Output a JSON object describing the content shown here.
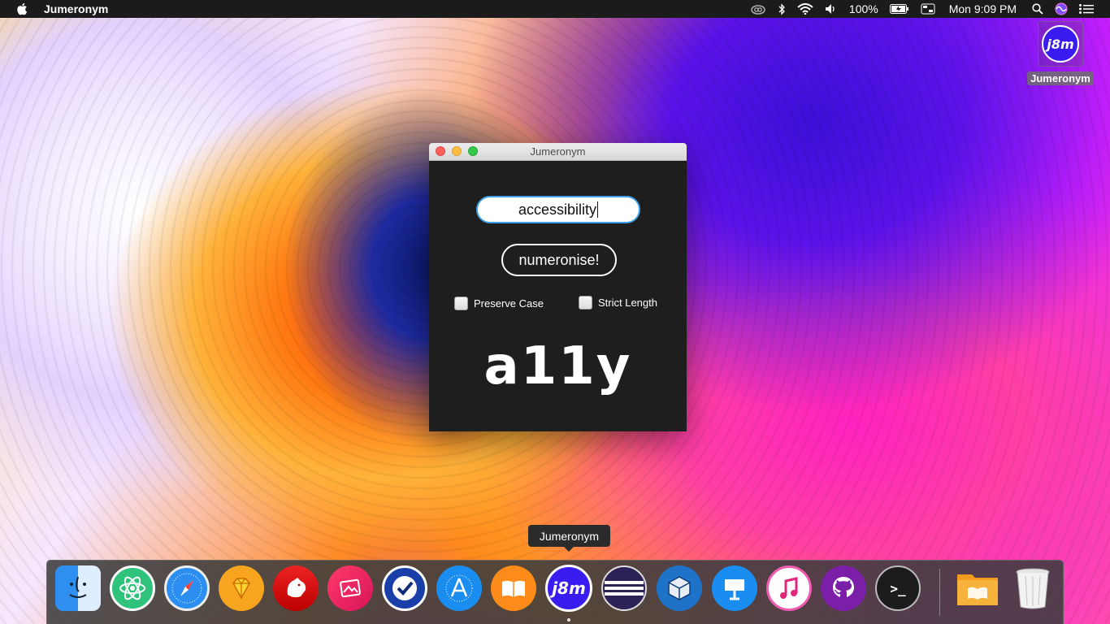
{
  "menubar": {
    "app_name": "Jumeronym",
    "battery": "100%",
    "clock": "Mon 9:09 PM"
  },
  "desktop": {
    "icon_label": "Jumeronym",
    "icon_text": "j8m"
  },
  "window": {
    "title": "Jumeronym",
    "input_value": "accessibility",
    "button_label": "numeronise!",
    "checkbox_preserve_case": "Preserve Case",
    "checkbox_strict_length": "Strict Length",
    "result": "a11y"
  },
  "dock": {
    "tooltip": "Jumeronym",
    "j8m_text": "j8m",
    "terminal_text": ">_",
    "apps": [
      "finder",
      "atom",
      "safari",
      "sketch",
      "bear",
      "photo-editor",
      "omnifocus",
      "app-store",
      "books",
      "jumeronym",
      "eclipse",
      "virtualbox",
      "keynote",
      "itunes",
      "github-desktop",
      "terminal",
      "downloads-folder",
      "trash"
    ]
  },
  "colors": {
    "accent": "#3f9fe6",
    "j8m_purple": "#3b1cf0",
    "window_bg": "#1e1e1e"
  }
}
